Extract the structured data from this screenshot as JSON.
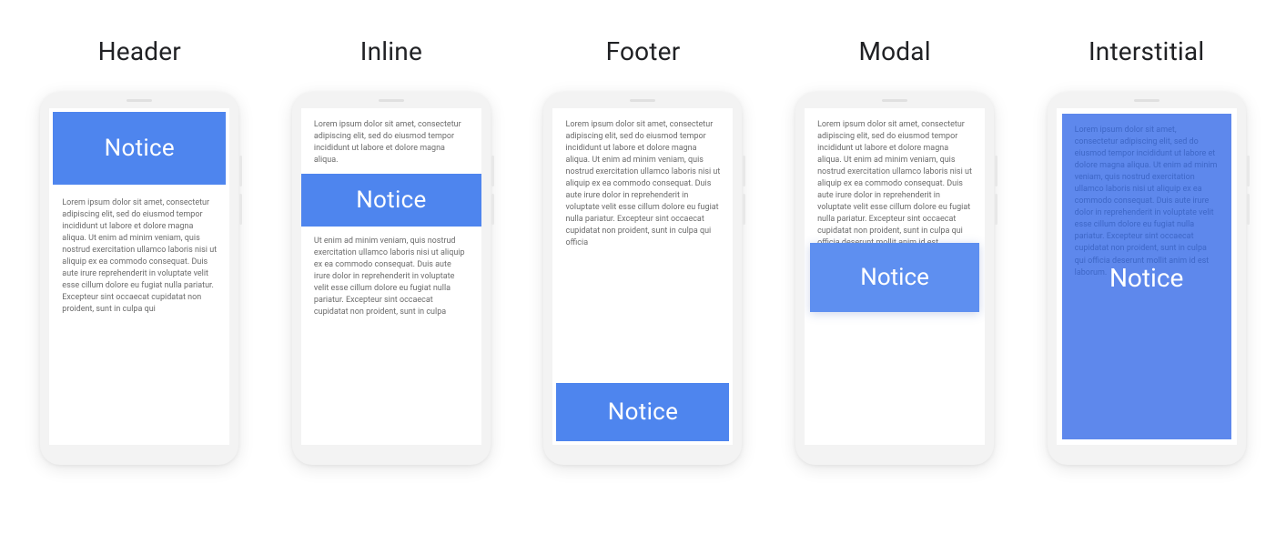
{
  "labels": {
    "header": "Header",
    "inline": "Inline",
    "footer": "Footer",
    "modal": "Modal",
    "interstitial": "Interstitial"
  },
  "notice_text": "Notice",
  "lorem": {
    "p1": "Lorem ipsum dolor sit amet, consectetur adipiscing elit, sed do eiusmod tempor incididunt ut labore et dolore magna aliqua. Ut enim ad minim veniam, quis nostrud exercitation ullamco laboris nisi ut aliquip ex ea commodo consequat. Duis aute irure reprehenderit in voluptate velit esse cillum dolore eu fugiat nulla pariatur. Excepteur sint occaecat cupidatat non proident, sunt in culpa qui",
    "short_top": "Lorem ipsum dolor sit amet, consectetur adipiscing elit, sed do eiusmod tempor incididunt ut labore et dolore magna aliqua.",
    "after_inline": "Ut enim ad minim veniam, quis nostrud exercitation ullamco laboris nisi ut aliquip ex ea commodo consequat. Duis aute irure dolor in reprehenderit in voluptate velit esse cillum dolore eu fugiat nulla pariatur. Excepteur sint occaecat cupidatat non proident, sunt in culpa",
    "footer_body": "Lorem ipsum dolor sit amet, consectetur adipiscing elit, sed do eiusmod tempor incididunt ut labore et dolore magna aliqua. Ut enim ad minim veniam, quis nostrud exercitation ullamco laboris nisi ut aliquip ex ea commodo consequat. Duis aute irure dolor in reprehenderit in voluptate velit esse cillum dolore eu fugiat nulla pariatur. Excepteur sint occaecat cupidatat non proident, sunt in culpa qui officia",
    "modal_body": "Lorem ipsum dolor sit amet, consectetur adipiscing elit, sed do eiusmod tempor incididunt ut labore et dolore magna aliqua. Ut enim ad minim veniam, quis nostrud exercitation ullamco laboris nisi ut aliquip ex ea commodo consequat. Duis aute irure dolor in reprehenderit in voluptate velit esse cillum dolore eu fugiat nulla pariatur. Excepteur sint occaecat cupidatat non proident, sunt in culpa qui officia deserunt mollit anim id est laborum.",
    "interstitial_body": "Lorem ipsum dolor sit amet, consectetur adipiscing elit, sed do eiusmod tempor incididunt ut labore et dolore magna aliqua. Ut enim ad minim veniam, quis nostrud exercitation ullamco laboris nisi ut aliquip ex ea commodo consequat. Duis aute irure dolor in reprehenderit in voluptate velit esse cillum dolore eu fugiat nulla pariatur. Excepteur sint occaecat cupidatat non proident, sunt in culpa qui officia deserunt mollit anim id est laborum."
  },
  "colors": {
    "notice_bg": "#4e85ee",
    "interstitial_bg": "#5e88ec",
    "phone_bg": "#f3f3f3",
    "text_muted": "#6b6b6b"
  }
}
